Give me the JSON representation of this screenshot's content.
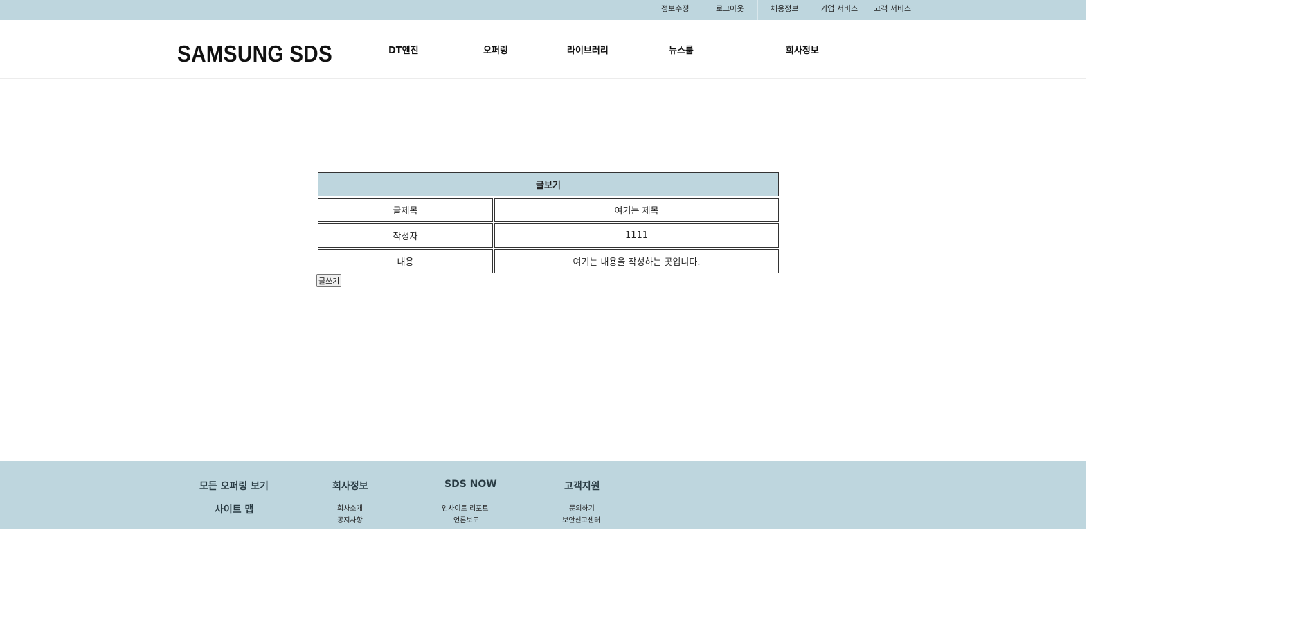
{
  "topbar": {
    "links": [
      "정보수정",
      "로그아웃",
      "채용정보",
      "기업 서비스",
      "고객 서비스"
    ]
  },
  "header": {
    "logo": "SAMSUNG SDS",
    "nav": [
      "DT엔진",
      "오퍼링",
      "라이브러리",
      "뉴스룸",
      "회사정보"
    ]
  },
  "board": {
    "title": "글보기",
    "rows": [
      {
        "label": "글제목",
        "value": "여기는 제목"
      },
      {
        "label": "작성자",
        "value": "1111"
      },
      {
        "label": "내용",
        "value": "여기는 내용을 작성하는 곳입니다."
      }
    ],
    "write_button": "글쓰기"
  },
  "footer": {
    "all_offerings": "모든 오퍼링 보기",
    "sitemap": "사이트 맵",
    "columns": [
      {
        "heading": "회사정보",
        "links": [
          "회사소개",
          "공지사항"
        ]
      },
      {
        "heading": "SDS NOW",
        "links": [
          "인사이트 리포트",
          "언론보도"
        ]
      },
      {
        "heading": "고객지원",
        "links": [
          "문의하기",
          "보안신고센터"
        ]
      }
    ]
  },
  "colors": {
    "accent_bar": "#bed6de",
    "footer_text": "#2a3c44"
  }
}
